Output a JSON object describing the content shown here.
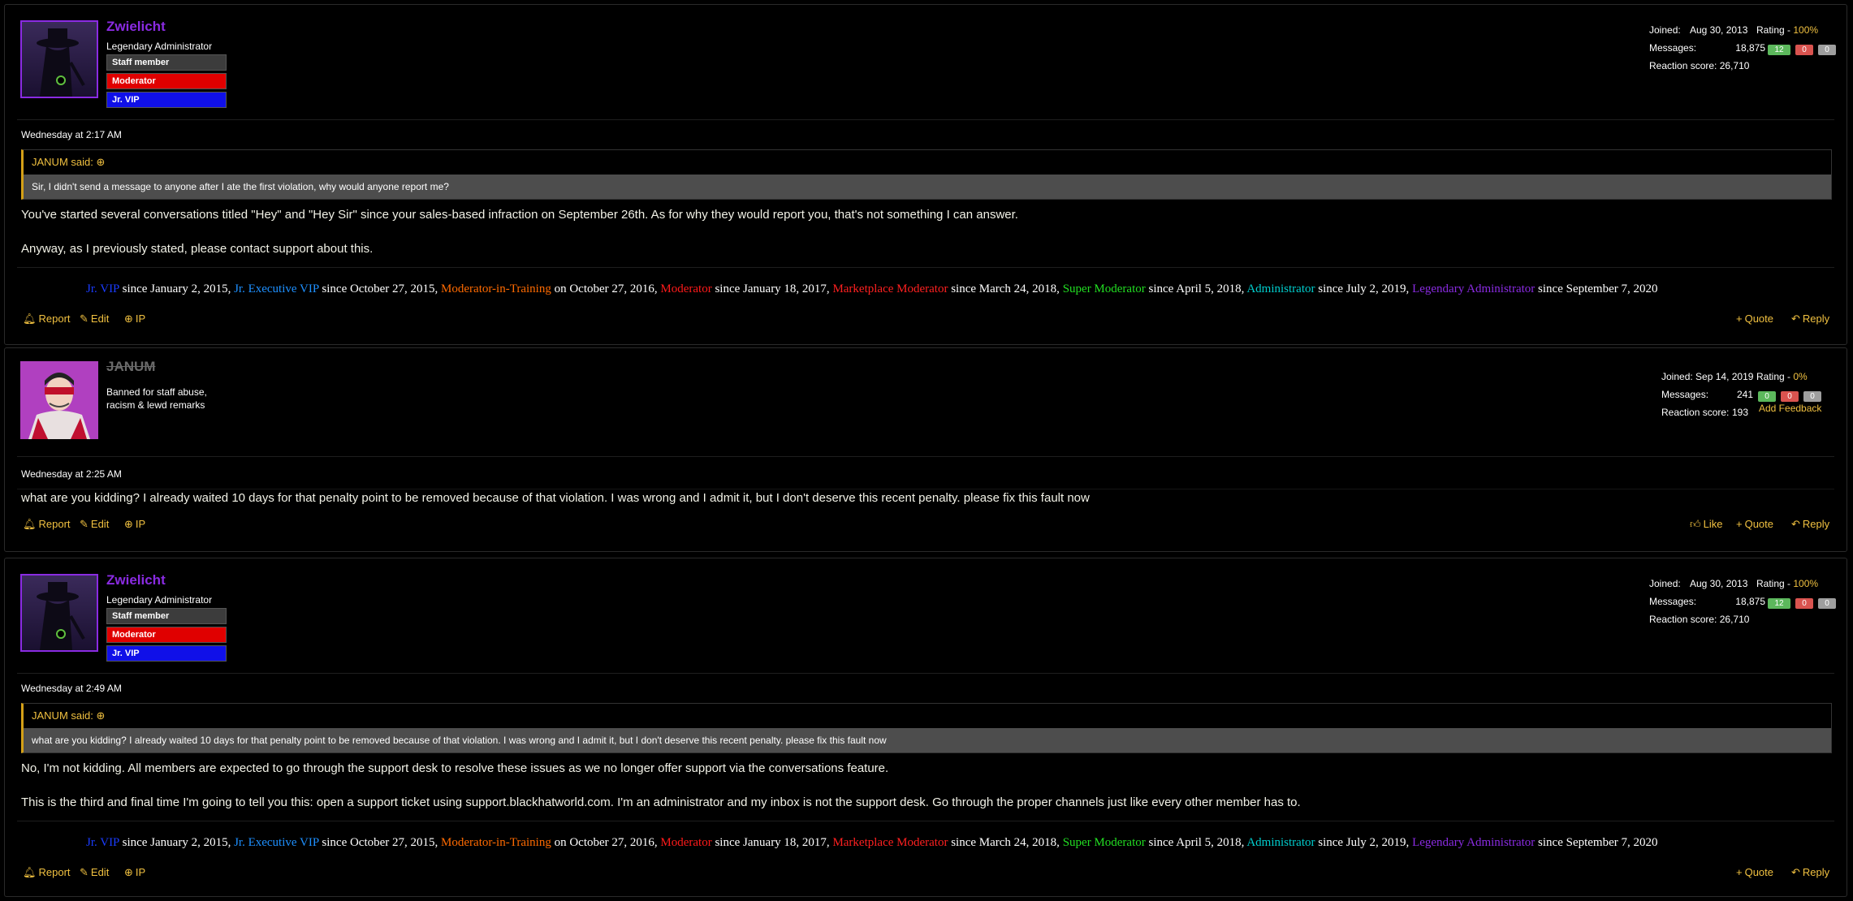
{
  "colors": {
    "admin_name": "#8a2be2",
    "gold": "#f0c040",
    "positive": "#5cb85c",
    "negative": "#d9534f",
    "neutral": "#9e9e9e"
  },
  "signature": [
    {
      "role": "Jr. VIP",
      "color": "#1a3cff",
      "since": " since January 2, 2015, "
    },
    {
      "role": "Jr. Executive VIP",
      "color": "#1e90ff",
      "since": " since October 27, 2015, "
    },
    {
      "role": "Moderator-in-Training",
      "color": "#ff6a00",
      "since": " on October 27, 2016, "
    },
    {
      "role": "Moderator",
      "color": "#ff1a1a",
      "since": " since January 18, 2017, "
    },
    {
      "role": "Marketplace Moderator",
      "color": "#ff2020",
      "since": " since March 24, 2018, "
    },
    {
      "role": "Super Moderator",
      "color": "#22dd22",
      "since": " since April 5, 2018, "
    },
    {
      "role": "Administrator",
      "color": "#00cccc",
      "since": " since July 2, 2019, "
    },
    {
      "role": "Legendary Administrator",
      "color": "#8a2be2",
      "since": " since September 7, 2020"
    }
  ],
  "post1": {
    "author": "Zwielicht",
    "title": "Legendary Administrator",
    "badges": [
      "Staff member",
      "Moderator",
      "Jr. VIP"
    ],
    "joined_label": "Joined:",
    "joined": "Aug 30, 2013",
    "rating_label": "Rating - ",
    "rating": "100%",
    "messages_label": "Messages:",
    "messages": "18,875",
    "fb_pos": "12",
    "fb_neg": "0",
    "fb_neu": "0",
    "reaction_label": "Reaction score:",
    "reaction": "26,710",
    "date": "Wednesday at 2:17 AM",
    "quote_author": "JANUM said: ",
    "quote_arrow": "⊕",
    "quote_text": "Sir, I didn't send a message to anyone after I ate the first violation, why would anyone report me?",
    "line1": "You've started several conversations titled \"Hey\" and \"Hey Sir\" since your sales-based infraction on September 26th. As for why they would report you, that's not something I can answer.",
    "line2": "Anyway, as I previously stated, please contact support about this.",
    "report": "Report",
    "edit": "Edit",
    "ip": "IP",
    "quote": "Quote",
    "reply": "Reply"
  },
  "post2": {
    "author": "JANUM",
    "title_l1": "Banned for staff abuse,",
    "title_l2": "racism & lewd remarks",
    "joined_label": "Joined:",
    "joined": "Sep 14, 2019",
    "rating_label": "Rating - ",
    "rating": "0%",
    "messages_label": "Messages:",
    "messages": "241",
    "fb_pos": "0",
    "fb_neg": "0",
    "fb_neu": "0",
    "reaction_label": "Reaction score:",
    "reaction": "193",
    "add_feedback": "Add Feedback",
    "date": "Wednesday at 2:25 AM",
    "line1": "what are you kidding? I already waited 10 days for that penalty point to be removed because of that violation. I was wrong and I admit it, but I don't deserve this recent penalty. please fix this fault now",
    "report": "Report",
    "edit": "Edit",
    "ip": "IP",
    "like": "Like",
    "quote": "Quote",
    "reply": "Reply"
  },
  "post3": {
    "author": "Zwielicht",
    "title": "Legendary Administrator",
    "badges": [
      "Staff member",
      "Moderator",
      "Jr. VIP"
    ],
    "joined_label": "Joined:",
    "joined": "Aug 30, 2013",
    "rating_label": "Rating - ",
    "rating": "100%",
    "messages_label": "Messages:",
    "messages": "18,875",
    "fb_pos": "12",
    "fb_neg": "0",
    "fb_neu": "0",
    "reaction_label": "Reaction score:",
    "reaction": "26,710",
    "date": "Wednesday at 2:49 AM",
    "quote_author": "JANUM said: ",
    "quote_arrow": "⊕",
    "quote_text": "what are you kidding? I already waited 10 days for that penalty point to be removed because of that violation. I was wrong and I admit it, but I don't deserve this recent penalty. please fix this fault now",
    "line1": "No, I'm not kidding. All members are expected to go through the support desk to resolve these issues as we no longer offer support via the conversations feature.",
    "line2": "This is the third and final time I'm going to tell you this: open a support ticket using support.blackhatworld.com. I'm an administrator and my inbox is not the support desk. Go through the proper channels just like every other member has to.",
    "report": "Report",
    "edit": "Edit",
    "ip": "IP",
    "quote": "Quote",
    "reply": "Reply"
  }
}
